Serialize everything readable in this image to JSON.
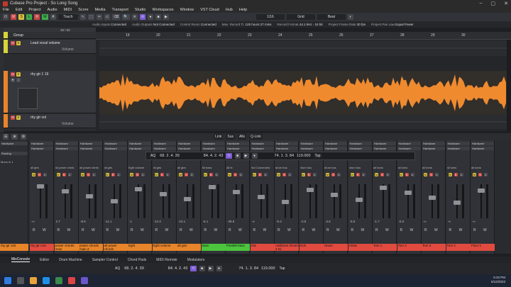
{
  "window": {
    "title": "Cubase Pro Project - So Long Song",
    "buttons": [
      "–",
      "▢",
      "✕"
    ]
  },
  "menu": [
    "File",
    "Edit",
    "Project",
    "Audio",
    "MIDI",
    "Score",
    "Media",
    "Transport",
    "Studio",
    "Workspaces",
    "Window",
    "VST Cloud",
    "Hub",
    "Help"
  ],
  "toolbar": {
    "automation_mode": "Touch",
    "grid": "Grid",
    "grid_type": "Beat",
    "quantize": "1/16",
    "buttons": [
      "M",
      "S",
      "L",
      "R",
      "W",
      "A"
    ]
  },
  "info": [
    {
      "k": "Audio Inputs",
      "v": "Connected"
    },
    {
      "k": "Audio Outputs",
      "v": "Not Connected"
    },
    {
      "k": "Control Room",
      "v": "Connected"
    },
    {
      "k": "Max. Record Ti.",
      "v": "125 hours 27 mins"
    },
    {
      "k": "Record Format",
      "v": "44.1 kHz - 24 bit"
    },
    {
      "k": "Project Frame Rate",
      "v": "30 fps"
    },
    {
      "k": "Project Pan Law",
      "v": "Equal Power"
    }
  ],
  "tracklist_header": "48 / 50",
  "tracks": [
    {
      "name": "Lead vocal volume",
      "sub": "Volume",
      "color": "#d6d43a"
    },
    {
      "name": "rhy gtr 1 19",
      "color": "#e8842a"
    },
    {
      "name": "rhy gtr vol",
      "sub": "Volume",
      "color": "#e8842a"
    }
  ],
  "group_label": "Group",
  "ruler": [
    "19",
    "20",
    "21",
    "22",
    "23",
    "24",
    "25",
    "26",
    "27",
    "28",
    "29",
    "30"
  ],
  "mixer_toolbar": {
    "link": "Link",
    "sus": "Sus",
    "alls": "Alls",
    "qlink": "Q-Link"
  },
  "transport": {
    "left_locator": "68. 2. 4. 39",
    "right_locator": "84. 4. 2. 43",
    "position": "74. 1. 3. 84",
    "tempo": "119.000",
    "sig": "Tap",
    "aq": "AQ"
  },
  "strips": [
    {
      "hw": "Hardware",
      "route": "all gtrs",
      "val": "-∞",
      "name": "rhy gtr root",
      "color": "#e14b3f"
    },
    {
      "hw": "Hardware",
      "route": "all power chrds",
      "val": "2.7",
      "name": "power chords main",
      "color": "#e8842a"
    },
    {
      "hw": "Hardware",
      "route": "all power chrds",
      "val": "-8.5",
      "name": "power chords main 2",
      "color": "#e8842a"
    },
    {
      "hw": "Hardware",
      "route": "all gtrs",
      "val": "-11.1",
      "name": "alt power chords",
      "color": "#e8842a"
    },
    {
      "hw": "Hardware",
      "route": "Eght volume",
      "val": "-1",
      "name": "Eght",
      "color": "#e8842a"
    },
    {
      "hw": "Hardware",
      "route": "all gtrs",
      "val": "-12.3",
      "name": "Eght volume",
      "color": "#e8842a"
    },
    {
      "hw": "Hardware",
      "route": "all gtrs",
      "val": "-10.1",
      "name": "alt gtrs",
      "color": "#e8842a"
    },
    {
      "hw": "Hardware",
      "route": "All bass",
      "val": "-6.1",
      "name": "bass",
      "color": "#4cc43e"
    },
    {
      "hw": "Hardware",
      "route": "All fx",
      "val": "-48.6",
      "name": "Parallel bass",
      "color": "#4cc43e"
    },
    {
      "hw": "Hardware",
      "route": "Not Connected",
      "val": "-∞",
      "name": "Kits",
      "color": "#e14b3f"
    },
    {
      "hw": "Hardware",
      "route": "drum bus",
      "val": "-9.4",
      "name": "Addictive Drums 2 01",
      "color": "#e14b3f"
    },
    {
      "hw": "Hardware",
      "route": "drum bus",
      "val": "-3.5",
      "name": "Kick",
      "color": "#e14b3f"
    },
    {
      "hw": "Hardware",
      "route": "drum bus",
      "val": "-4.6",
      "name": "Snare",
      "color": "#e14b3f"
    },
    {
      "hw": "Hardware",
      "route": "drum bus",
      "val": "-5.6",
      "name": "HiHat",
      "color": "#e14b3f"
    },
    {
      "hw": "Hardware",
      "route": "all toms",
      "val": "-1.7",
      "name": "Tom 1",
      "color": "#e14b3f"
    },
    {
      "hw": "Hardware",
      "route": "all toms",
      "val": "-6.0",
      "name": "Tom 2",
      "color": "#e14b3f"
    },
    {
      "hw": "Hardware",
      "route": "all toms",
      "val": "-∞",
      "name": "Tom 3",
      "color": "#e14b3f"
    },
    {
      "hw": "Hardware",
      "route": "all toms",
      "val": "-∞",
      "name": "Tom 4",
      "color": "#e14b3f"
    },
    {
      "hw": "Hardware",
      "route": "all toms",
      "val": "-∞",
      "name": "Floor 1",
      "color": "#e14b3f"
    }
  ],
  "left_channel": {
    "hw": "Hardware",
    "routing": "Routing",
    "route": "Mono in 1",
    "name": "rhy gtr 119"
  },
  "bottom_tabs": [
    "MixConsole",
    "Editor",
    "Drum Machine",
    "Sampler Control",
    "Chord Pads",
    "MIDI Remote",
    "Modulators"
  ],
  "bottom_transport": {
    "left": "68. 2. 4. 39",
    "right": "84. 4. 2. 43",
    "pos": "74. 1. 3. 84",
    "tempo": "119.000",
    "sig": "Tap"
  },
  "clock": {
    "time": "6:33 PM",
    "date": "6/12/2023"
  }
}
